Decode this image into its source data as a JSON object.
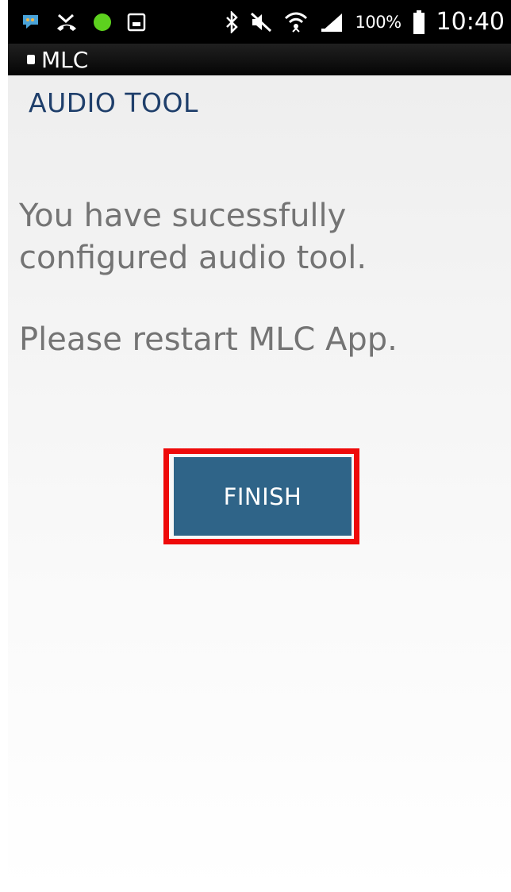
{
  "status_bar": {
    "battery_percent": "100%",
    "time": "10:40",
    "icons": [
      "chat-icon",
      "missed-call-icon",
      "green-dot-icon",
      "gallery-icon",
      "bluetooth-icon",
      "mute-icon",
      "wifi-icon",
      "signal-icon",
      "battery-icon"
    ]
  },
  "app_bar": {
    "title": "MLC"
  },
  "header": {
    "title": "AUDIO TOOL"
  },
  "content": {
    "message": "You have sucessfully configured audio tool.",
    "restart_note": "Please restart MLC App."
  },
  "actions": {
    "finish_label": "FINISH"
  },
  "colors": {
    "button": "#2f6488",
    "highlight": "#ee0a0a",
    "header_text": "#1f3f6b",
    "body_text": "#747474"
  }
}
